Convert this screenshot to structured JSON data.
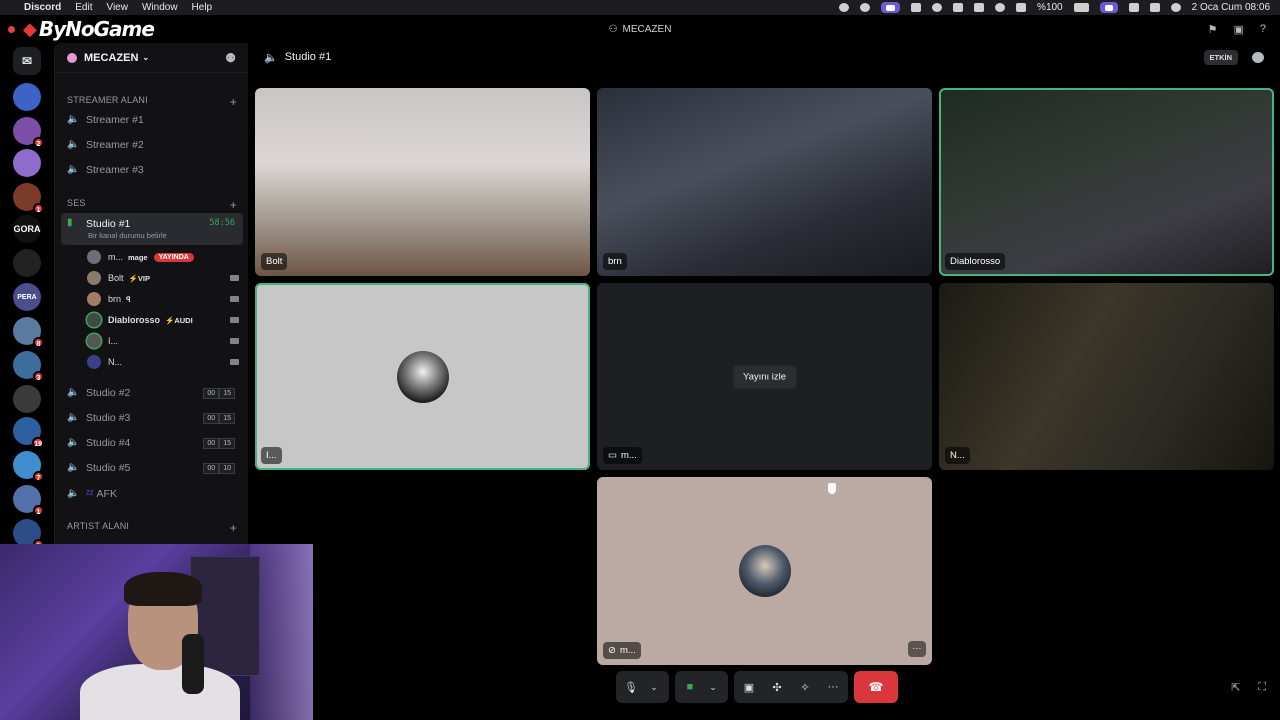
{
  "menubar": {
    "app": "Discord",
    "items": [
      "Edit",
      "View",
      "Window",
      "Help"
    ],
    "battery": "%100",
    "datetime": "2 Oca Cum  08:06"
  },
  "window": {
    "brand": "ByNoGame",
    "title": "MECAZEN"
  },
  "servers": [
    {
      "label": "",
      "badge": "",
      "color": "#3d63c9"
    },
    {
      "label": "",
      "badge": "2",
      "color": "#7b4fa8"
    },
    {
      "label": "",
      "badge": "",
      "color": "#8f6cc9"
    },
    {
      "label": "",
      "badge": "1",
      "color": "#7a3b2b"
    },
    {
      "label": "GORA",
      "badge": "",
      "color": "#111111"
    },
    {
      "label": "",
      "badge": "",
      "color": "#222222"
    },
    {
      "label": "PERA",
      "badge": "",
      "color": "#4a4e8c"
    },
    {
      "label": "",
      "badge": "8",
      "color": "#5a7aa0"
    },
    {
      "label": "",
      "badge": "3",
      "color": "#3c6d9b"
    },
    {
      "label": "",
      "badge": "",
      "color": "#3a3a3a"
    },
    {
      "label": "",
      "badge": "19",
      "color": "#2e5f9e"
    },
    {
      "label": "",
      "badge": "7",
      "color": "#3f8fcf"
    },
    {
      "label": "",
      "badge": "1",
      "color": "#5470a8"
    },
    {
      "label": "",
      "badge": "1",
      "color": "#2c4d86"
    }
  ],
  "sidebar": {
    "server_name": "MECAZEN",
    "categories": {
      "streamer": "STREAMER ALANI",
      "ses": "SES",
      "artist": "ARTIST ALANI"
    },
    "streamer_channels": [
      "Streamer #1",
      "Streamer #2",
      "Streamer #3"
    ],
    "active_channel": {
      "name": "Studio #1",
      "timer": "58:56",
      "status": "Bir kanal durumu belirle"
    },
    "voice_users": [
      {
        "name": "m...",
        "tag": "mage",
        "live": "YAYINDA"
      },
      {
        "name": "Bolt",
        "tag": "⚡VIP",
        "live": ""
      },
      {
        "name": "brn",
        "tag": "ꟼ",
        "live": ""
      },
      {
        "name": "Diablorosso",
        "tag": "⚡AUDI",
        "live": ""
      },
      {
        "name": "I...",
        "tag": "",
        "live": ""
      },
      {
        "name": "N...",
        "tag": "",
        "live": ""
      }
    ],
    "voice_channels": [
      {
        "name": "Studio #2",
        "a": "00",
        "b": "15"
      },
      {
        "name": "Studio #3",
        "a": "00",
        "b": "15"
      },
      {
        "name": "Studio #4",
        "a": "00",
        "b": "15"
      },
      {
        "name": "Studio #5",
        "a": "00",
        "b": "10"
      }
    ],
    "afk": "AFK"
  },
  "main": {
    "channel": "Studio #1",
    "etkin": "ETKİN",
    "tiles": [
      {
        "label": "Bolt"
      },
      {
        "label": "brn"
      },
      {
        "label": "Diablorosso"
      },
      {
        "label": "I..."
      },
      {
        "label": "m...",
        "watch": "Yayını izle"
      },
      {
        "label": "N..."
      },
      {
        "label": "m..."
      }
    ]
  },
  "colors": {
    "accent_green": "#43b581",
    "danger": "#da373c",
    "brand_red": "#e53935"
  }
}
